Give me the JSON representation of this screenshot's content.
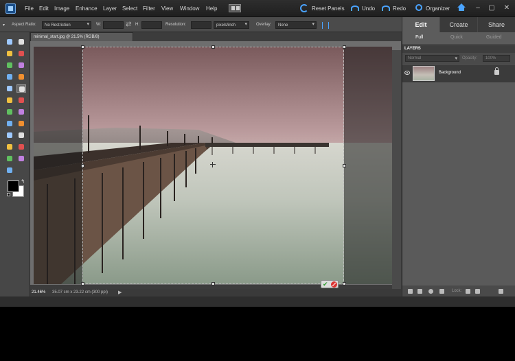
{
  "menubar": {
    "items": [
      "File",
      "Edit",
      "Image",
      "Enhance",
      "Layer",
      "Select",
      "Filter",
      "View",
      "Window",
      "Help"
    ],
    "actions": {
      "reset_panels": "Reset Panels",
      "undo": "Undo",
      "redo": "Redo",
      "organizer": "Organizer"
    },
    "window_controls": [
      "–",
      "▢",
      "✕"
    ]
  },
  "options": {
    "tool_preset_arrow": "▾",
    "aspect_ratio_label": "Aspect Ratio:",
    "aspect_ratio_value": "No Restriction",
    "width_label": "W:",
    "width_value": "",
    "swap_glyph": "⇄",
    "height_label": "H:",
    "height_value": "",
    "resolution_label": "Resolution:",
    "resolution_value": "",
    "resolution_units": "pixels/inch",
    "overlay_label": "Overlay:",
    "overlay_value": "None"
  },
  "toolbox": {
    "tools": [
      "move-tool",
      "zoom-tool",
      "hand-tool",
      "eyedropper-tool",
      "marquee-tool",
      "lasso-tool",
      "magic-wand-tool",
      "quick-selection-tool",
      "type-tool",
      "crop-tool",
      "cookie-cutter-tool",
      "recompose-tool",
      "red-eye-tool",
      "spot-healing-tool",
      "clone-stamp-tool",
      "eraser-tool",
      "brush-tool",
      "smart-brush-tool",
      "paint-bucket-tool",
      "gradient-tool",
      "shape-tool",
      "blur-tool",
      "sponge-tool"
    ],
    "active_tool": "crop-tool",
    "foreground_color": "#000000",
    "background_color": "#ffffff"
  },
  "document": {
    "tab_title": "minimal_start.jpg @ 21.5% (RGB/8)",
    "zoom": "21.46%",
    "info": "35.07 cm x 23.22 cm (300 ppi)",
    "info_arrow": "▶",
    "commit_glyph": "✔"
  },
  "panel": {
    "modes": [
      "Edit",
      "Create",
      "Share"
    ],
    "active_mode": "Edit",
    "sub_tabs": [
      "Full",
      "Quick",
      "Guided"
    ],
    "active_sub_tab": "Full",
    "layers": {
      "header": "LAYERS",
      "blend_mode": "Normal",
      "opacity_label": "Opacity:",
      "opacity_value": "100%",
      "lock_label": "Lock:",
      "rows": [
        {
          "name": "Background",
          "visible": true,
          "locked": true
        }
      ]
    }
  },
  "colors": {
    "accent": "#4aa3ff",
    "menubar_bg": "#262626",
    "panel_bg": "#474747",
    "selected_layer_bg": "#3b3b3b"
  }
}
